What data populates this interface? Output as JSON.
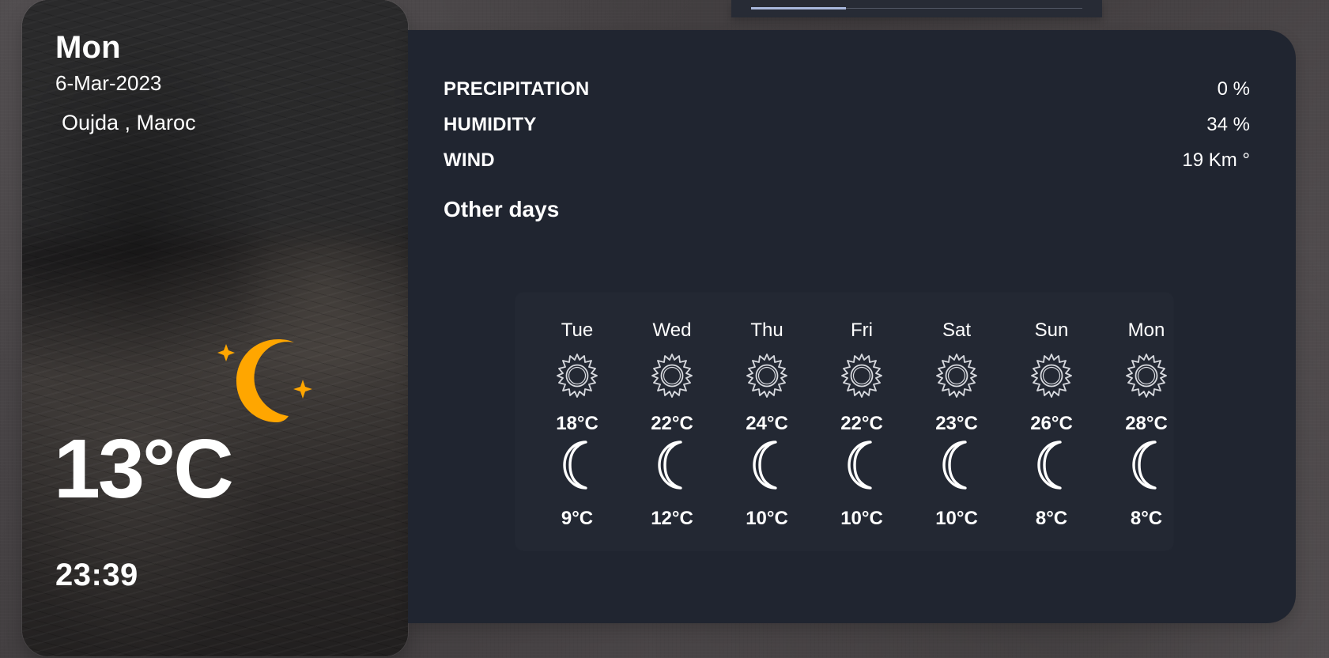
{
  "current": {
    "day": "Mon",
    "date": "6-Mar-2023",
    "location": " Oujda , Maroc",
    "temperature": "13°C",
    "time": "23:39",
    "icon": "moon-stars-icon"
  },
  "details": {
    "precipitation_label": "PRECIPITATION",
    "precipitation_value": "0 %",
    "humidity_label": "HUMIDITY",
    "humidity_value": "34 %",
    "wind_label": "WIND",
    "wind_value": "19 Km °"
  },
  "other_days": {
    "title": "Other days",
    "days": [
      {
        "day": "Tue",
        "high": "18°C",
        "low": "9°C",
        "day_icon": "sun-icon",
        "night_icon": "moon-icon"
      },
      {
        "day": "Wed",
        "high": "22°C",
        "low": "12°C",
        "day_icon": "sun-icon",
        "night_icon": "moon-icon"
      },
      {
        "day": "Thu",
        "high": "24°C",
        "low": "10°C",
        "day_icon": "sun-icon",
        "night_icon": "moon-icon"
      },
      {
        "day": "Fri",
        "high": "22°C",
        "low": "10°C",
        "day_icon": "sun-icon",
        "night_icon": "moon-icon"
      },
      {
        "day": "Sat",
        "high": "23°C",
        "low": "10°C",
        "day_icon": "sun-icon",
        "night_icon": "moon-icon"
      },
      {
        "day": "Sun",
        "high": "26°C",
        "low": "8°C",
        "day_icon": "sun-icon",
        "night_icon": "moon-icon"
      },
      {
        "day": "Mon",
        "high": "28°C",
        "low": "8°C",
        "day_icon": "sun-icon",
        "night_icon": "moon-icon"
      }
    ]
  },
  "colors": {
    "accent_moon": "#ffa600",
    "panel_background": "#202530",
    "text": "#ffffff"
  }
}
